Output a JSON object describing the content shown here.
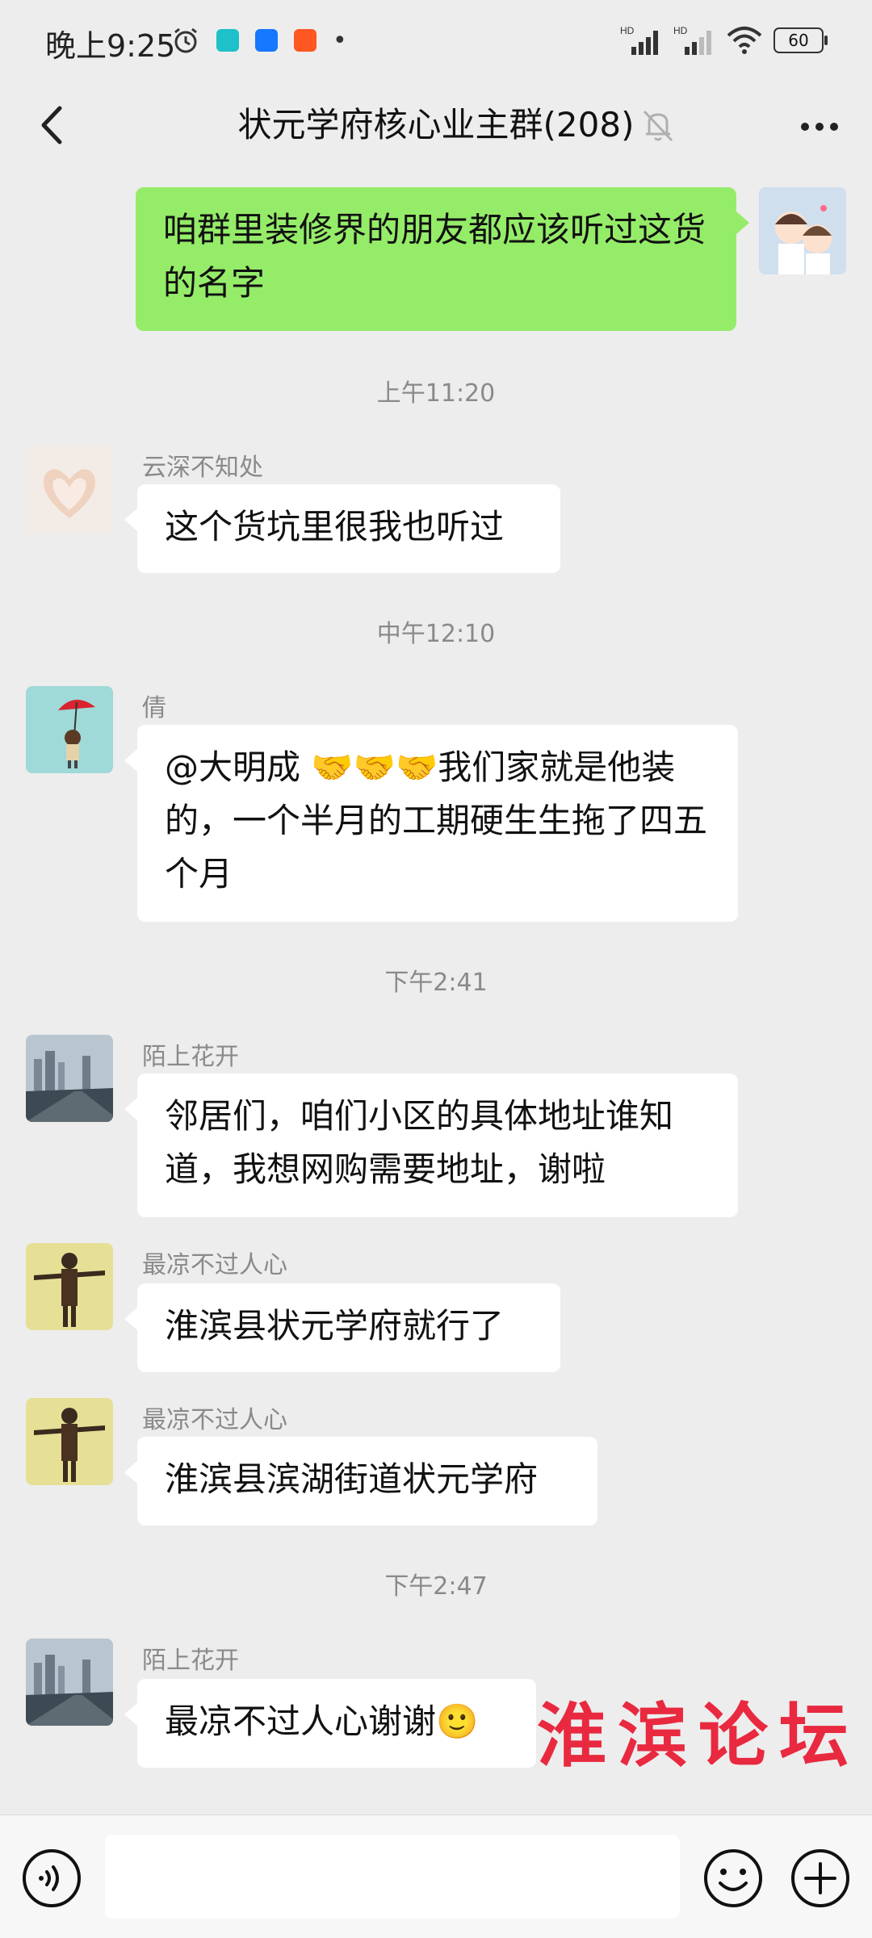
{
  "status_bar": {
    "time": "晚上9:25",
    "signal1_label": "HD",
    "signal2_label": "HD",
    "battery": "60"
  },
  "header": {
    "title": "状元学府核心业主群(208)"
  },
  "messages": [
    {
      "type": "self",
      "text": "咱群里装修界的朋友都应该听过这货的名字"
    },
    {
      "type": "time",
      "text": "上午11:20"
    },
    {
      "type": "other",
      "sender": "云深不知处",
      "text": "这个货坑里很我也听过"
    },
    {
      "type": "time",
      "text": "中午12:10"
    },
    {
      "type": "other",
      "sender": "倩",
      "text": "@大明成 🤝🤝🤝我们家就是他装的，一个半月的工期硬生生拖了四五个月"
    },
    {
      "type": "time",
      "text": "下午2:41"
    },
    {
      "type": "other",
      "sender": "陌上花开",
      "text": "邻居们，咱们小区的具体地址谁知道，我想网购需要地址，谢啦"
    },
    {
      "type": "other",
      "sender": "最凉不过人心",
      "text": "淮滨县状元学府就行了"
    },
    {
      "type": "other",
      "sender": "最凉不过人心",
      "text": "淮滨县滨湖街道状元学府"
    },
    {
      "type": "time",
      "text": "下午2:47"
    },
    {
      "type": "other",
      "sender": "陌上花开",
      "text": "最凉不过人心谢谢🙂"
    }
  ],
  "watermark": "淮滨论坛",
  "input_bar": {
    "placeholder": ""
  },
  "colors": {
    "background": "#ededed",
    "self_bubble": "#95ec69",
    "other_bubble": "#ffffff",
    "watermark": "#e8293f"
  }
}
